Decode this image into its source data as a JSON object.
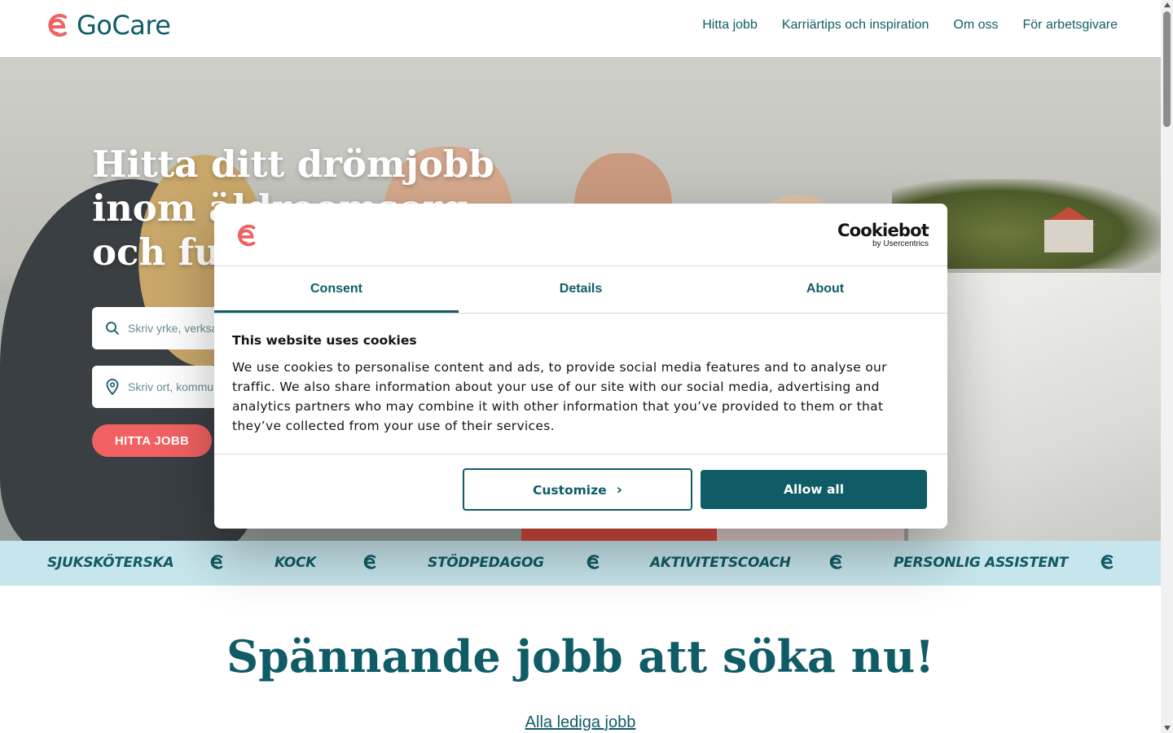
{
  "brand": {
    "name": "Go Care",
    "logo_text": "GoCare"
  },
  "nav": {
    "items": [
      "Hitta jobb",
      "Karriärtips och inspiration",
      "Om oss",
      "För arbetsgivare"
    ]
  },
  "hero": {
    "title": "Hitta ditt drömjobb inom äldreomsorg och funktionshinder",
    "search_placeholder": "Skriv yrke, verksamhet...",
    "location_placeholder": "Skriv ort, kommun...",
    "button_label": "HITTA JOBB"
  },
  "ticker": {
    "items": [
      "SJUKSKÖTERSKA",
      "KOCK",
      "STÖDPEDAGOG",
      "AKTIVITETSCOACH",
      "PERSONLIG ASSISTENT"
    ]
  },
  "section": {
    "title": "Spännande jobb att söka nu!",
    "link": "Alla lediga jobb"
  },
  "cookie_dialog": {
    "provider": "Cookiebot",
    "provider_sub": "by Usercentrics",
    "tabs": [
      {
        "label": "Consent",
        "active": true
      },
      {
        "label": "Details",
        "active": false
      },
      {
        "label": "About",
        "active": false
      }
    ],
    "title": "This website uses cookies",
    "text": "We use cookies to personalise content and ads, to provide social media features and to analyse our traffic. We also share information about your use of our site with our social media, advertising and analytics partners who may combine it with other information that you’ve provided to them or that they’ve collected from your use of their services.",
    "customize_label": "Customize",
    "allow_label": "Allow all"
  },
  "colors": {
    "brand_teal": "#0f5c66",
    "brand_coral": "#f26161",
    "ticker_bg": "#c7e5ec"
  }
}
